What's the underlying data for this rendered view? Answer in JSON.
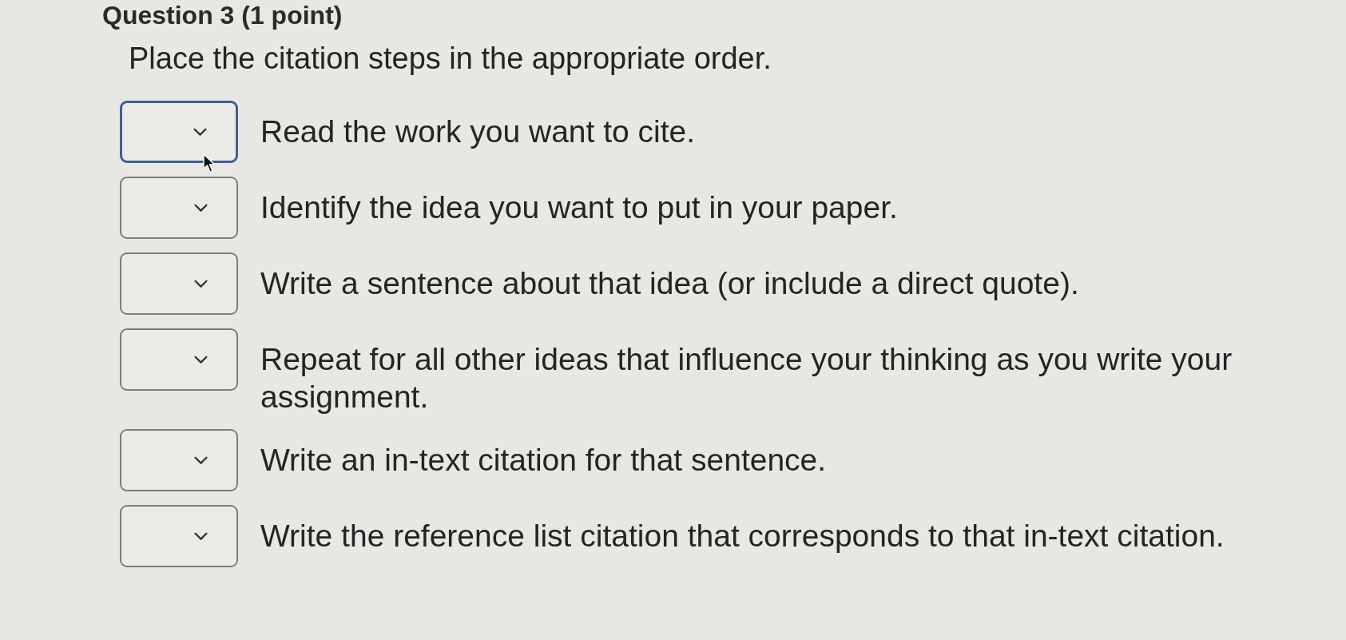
{
  "question_title": "Question 3 (1 point)",
  "prompt": "Place the citation steps in the appropriate order.",
  "steps": [
    {
      "text": "Read the work you want to cite.",
      "focused": true
    },
    {
      "text": "Identify the idea you want to put in your paper.",
      "focused": false
    },
    {
      "text": "Write a sentence about that idea (or include a direct quote).",
      "focused": false
    },
    {
      "text": "Repeat for all other ideas that influence your thinking as you write your assignment.",
      "focused": false
    },
    {
      "text": "Write an in-text citation for that sentence.",
      "focused": false
    },
    {
      "text": "Write the reference list citation that corresponds to that in-text citation.",
      "focused": false
    }
  ]
}
